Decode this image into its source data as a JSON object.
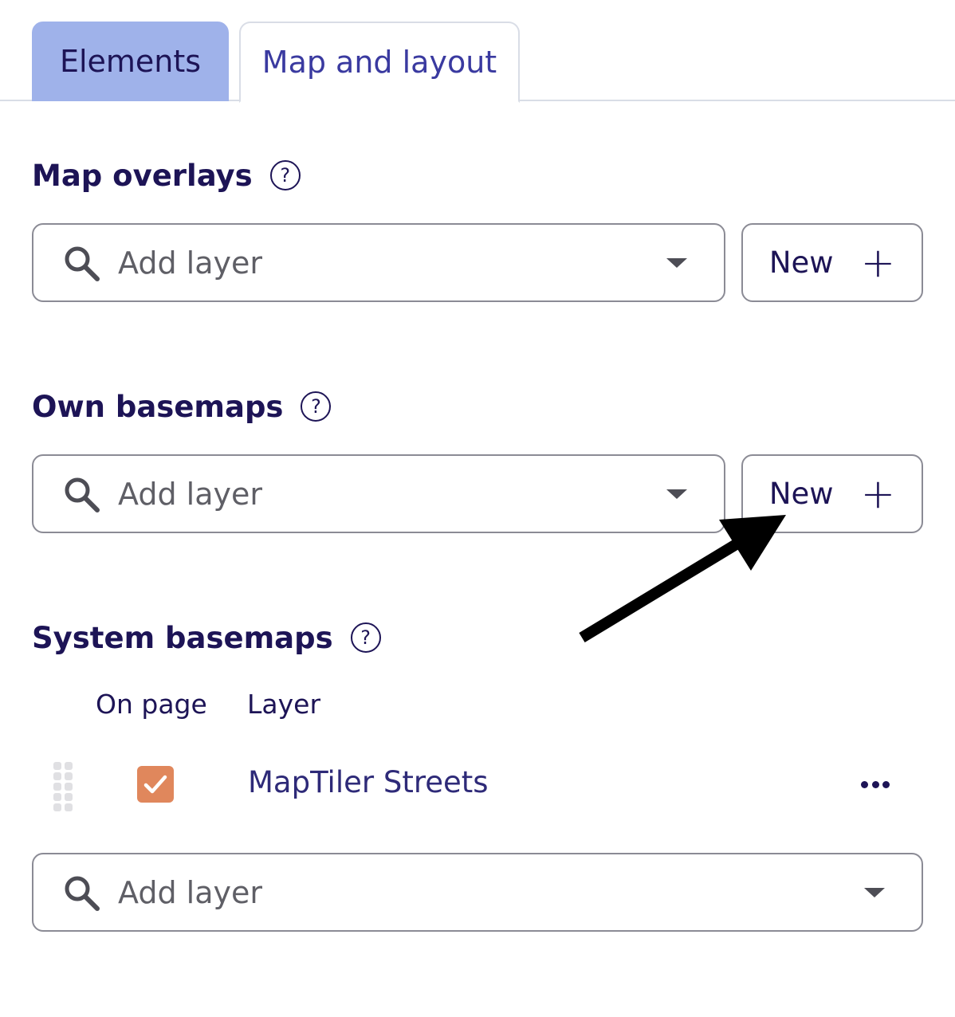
{
  "tabs": [
    {
      "label": "Elements",
      "active": true
    },
    {
      "label": "Map and layout",
      "active": false
    }
  ],
  "sections": {
    "overlays": {
      "title": "Map overlays",
      "help": "?",
      "placeholder": "Add layer",
      "new_label": "New",
      "new_icon": "+"
    },
    "own_basemaps": {
      "title": "Own basemaps",
      "help": "?",
      "placeholder": "Add layer",
      "new_label": "New",
      "new_icon": "+"
    },
    "system_basemaps": {
      "title": "System basemaps",
      "help": "?",
      "columns": {
        "on_page": "On page",
        "layer": "Layer"
      },
      "rows": [
        {
          "label": "MapTiler Streets",
          "checked": true
        }
      ],
      "placeholder": "Add layer"
    }
  },
  "colors": {
    "accent": "#9fb2ea",
    "text": "#1d1456",
    "checkbox": "#e0875c"
  }
}
